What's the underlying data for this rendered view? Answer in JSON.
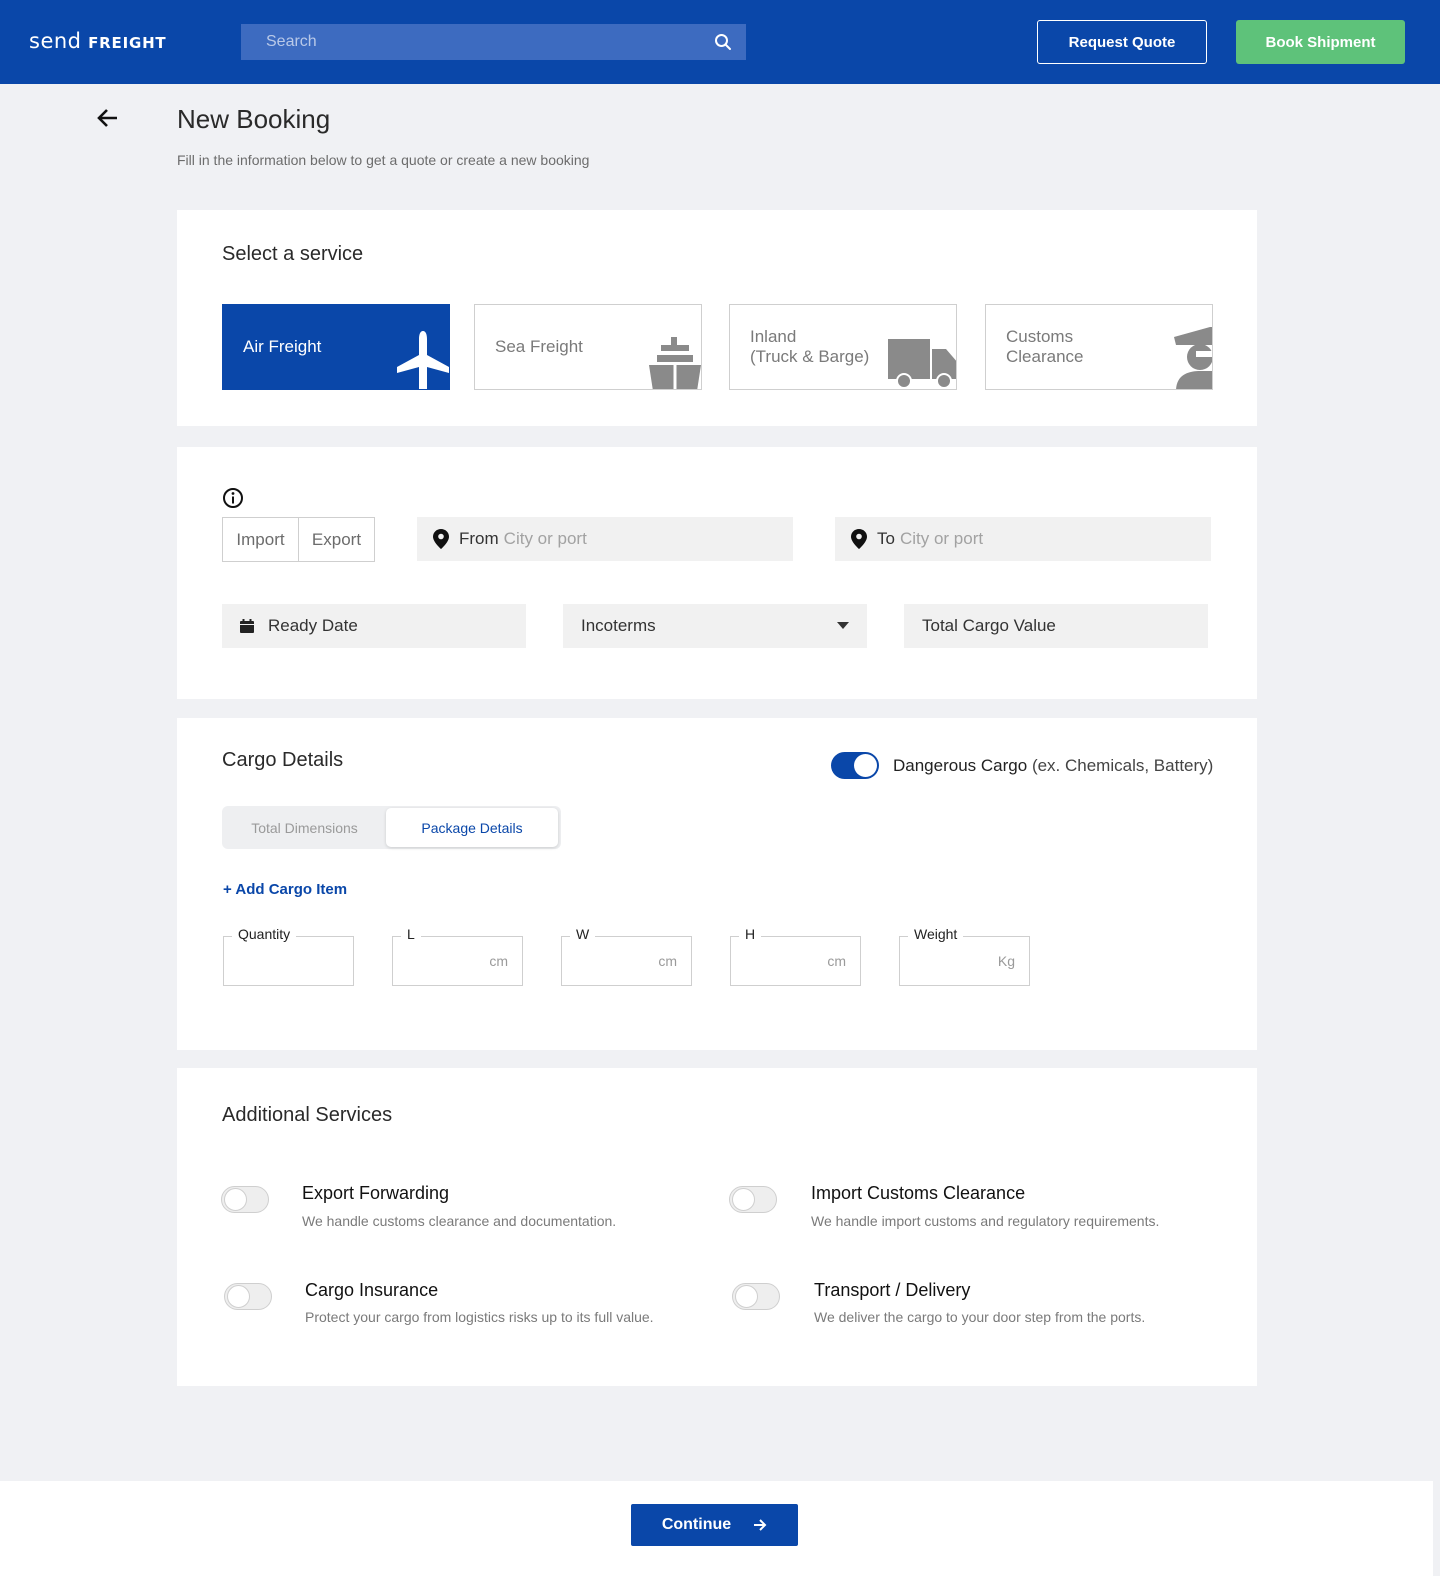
{
  "header": {
    "logo_part1": "send",
    "logo_part2": "FREIGHT",
    "search_placeholder": "Search",
    "request_quote_label": "Request Quote",
    "book_shipment_label": "Book Shipment"
  },
  "page": {
    "title": "New Booking",
    "subtitle": "Fill in the information below to get a quote or create a new booking"
  },
  "service": {
    "title": "Select a service",
    "options": [
      {
        "label": "Air Freight",
        "icon": "airplane-icon",
        "selected": true
      },
      {
        "label": "Sea Freight",
        "icon": "ship-icon",
        "selected": false
      },
      {
        "label_line1": "Inland",
        "label_line2": "(Truck & Barge)",
        "icon": "truck-icon",
        "selected": false
      },
      {
        "label_line1": "Customs",
        "label_line2": "Clearance",
        "icon": "customs-officer-icon",
        "selected": false
      }
    ]
  },
  "route": {
    "import_label": "Import",
    "export_label": "Export",
    "from_label": "From",
    "from_placeholder": "City or port",
    "to_label": "To",
    "to_placeholder": "City or port",
    "ready_date_label": "Ready Date",
    "incoterms_label": "Incoterms",
    "total_cargo_value_label": "Total Cargo Value"
  },
  "cargo": {
    "title": "Cargo Details",
    "dangerous_label": "Dangerous Cargo",
    "dangerous_extra": "(ex. Chemicals, Battery)",
    "dangerous_on": true,
    "tab_total": "Total Dimensions",
    "tab_package": "Package Details",
    "active_tab": "Package Details",
    "add_item_label": "+ Add Cargo Item",
    "fields": [
      {
        "label": "Quantity",
        "unit": ""
      },
      {
        "label": "L",
        "unit": "cm"
      },
      {
        "label": "W",
        "unit": "cm"
      },
      {
        "label": "H",
        "unit": "cm"
      },
      {
        "label": "Weight",
        "unit": "Kg"
      }
    ]
  },
  "additional": {
    "title": "Additional Services",
    "items": [
      {
        "title": "Export Forwarding",
        "desc": "We handle customs clearance and documentation.",
        "enabled": false
      },
      {
        "title": "Import Customs Clearance",
        "desc": "We handle import customs and regulatory requirements.",
        "enabled": false
      },
      {
        "title": "Cargo Insurance",
        "desc": "Protect your cargo from logistics risks up to its full value.",
        "enabled": false
      },
      {
        "title": "Transport / Delivery",
        "desc": "We deliver the cargo to your door step from the ports.",
        "enabled": false
      }
    ]
  },
  "footer": {
    "continue_label": "Continue"
  },
  "colors": {
    "brand": "#0a47a9",
    "success": "#5ec27a",
    "background": "#f0f1f4"
  }
}
